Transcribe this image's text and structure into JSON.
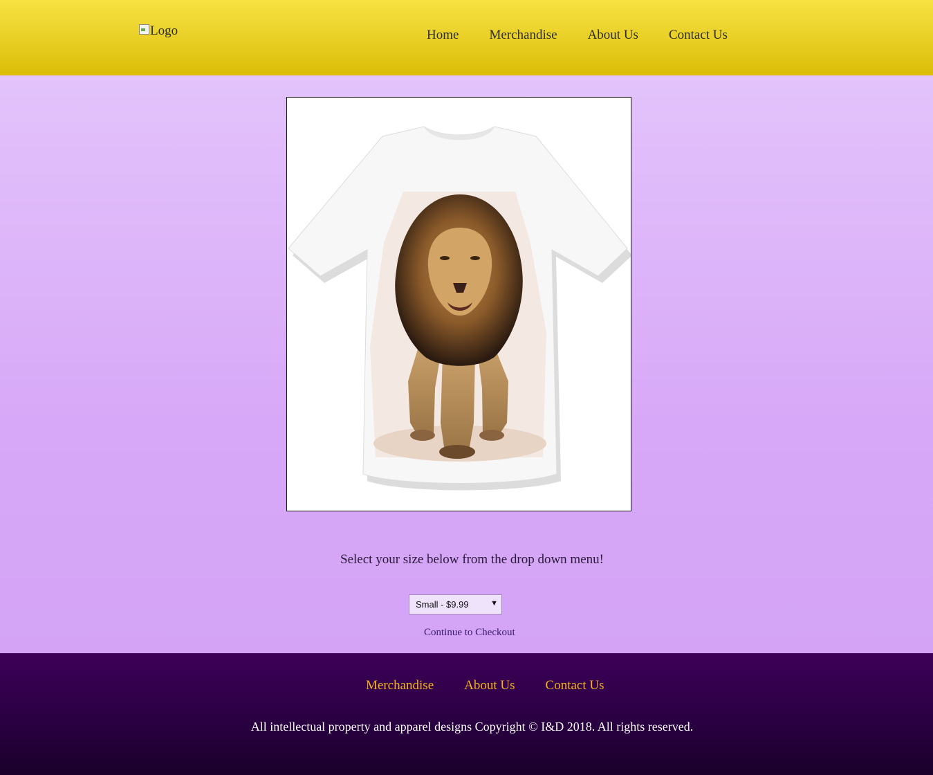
{
  "header": {
    "logo_alt": "Logo",
    "nav": [
      {
        "label": "Home"
      },
      {
        "label": "Merchandise"
      },
      {
        "label": "About Us"
      },
      {
        "label": "Contact Us"
      }
    ]
  },
  "product": {
    "image_description_icon": "tshirt-lion-icon",
    "tagline": "Select your size below from the drop down menu!",
    "size_selected": "Small - $9.99",
    "checkout_label": "Continue to Checkout"
  },
  "footer": {
    "nav": [
      {
        "label": "Merchandise"
      },
      {
        "label": "About Us"
      },
      {
        "label": "Contact Us"
      }
    ],
    "copyright": "All intellectual property and apparel designs Copyright © I&D 2018. All rights reserved."
  },
  "colors": {
    "header": "#ebd22a",
    "main": "#d7a8f7",
    "footer": "#2a0042",
    "footer_link": "#f2b31b"
  }
}
